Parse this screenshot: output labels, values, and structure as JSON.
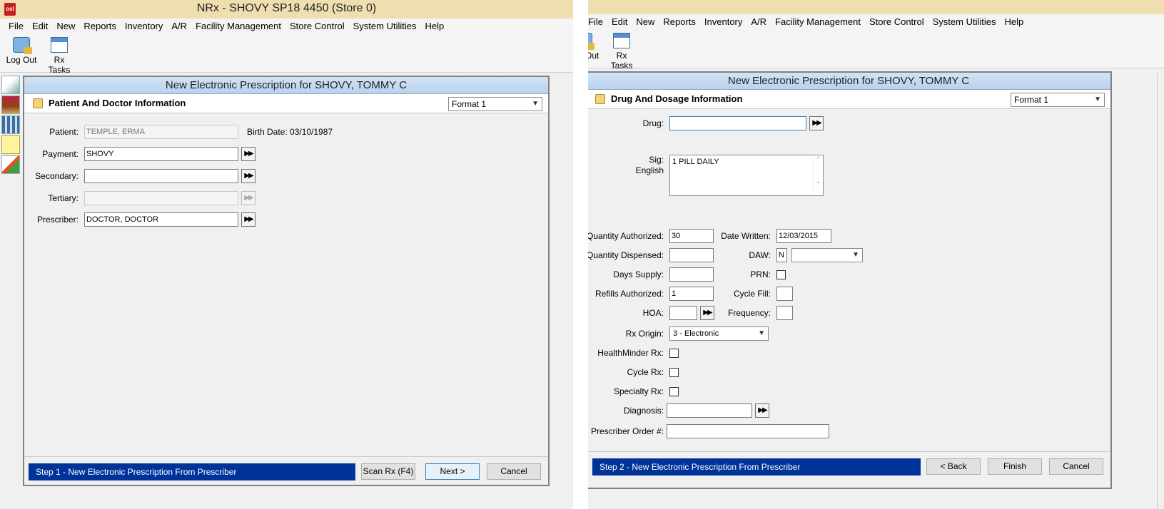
{
  "left": {
    "title": "NRx - SHOVY SP18 4450 (Store 0)",
    "app_icon": "osl",
    "menu": [
      "File",
      "Edit",
      "New",
      "Reports",
      "Inventory",
      "A/R",
      "Facility Management",
      "Store Control",
      "System Utilities",
      "Help"
    ],
    "toolbar": {
      "logout": "Log Out",
      "rxtasks": "Rx Tasks"
    },
    "dialog_title": "New Electronic Prescription  for SHOVY, TOMMY C",
    "section": "Patient And Doctor Information",
    "format": "Format 1",
    "labels": {
      "patient": "Patient:",
      "payment": "Payment:",
      "secondary": "Secondary:",
      "tertiary": "Tertiary:",
      "prescriber": "Prescriber:",
      "birth": "Birth Date: 03/10/1987"
    },
    "values": {
      "patient": "TEMPLE, ERMA",
      "payment": "SHOVY",
      "secondary": "",
      "tertiary": "",
      "prescriber": "DOCTOR, DOCTOR"
    },
    "step": "Step 1 - New Electronic Prescription From Prescriber",
    "buttons": {
      "scan": "Scan Rx (F4)",
      "next": "Next >",
      "cancel": "Cancel"
    }
  },
  "right": {
    "app_icon": "osl",
    "menu": [
      "File",
      "Edit",
      "New",
      "Reports",
      "Inventory",
      "A/R",
      "Facility Management",
      "Store Control",
      "System Utilities",
      "Help"
    ],
    "toolbar": {
      "logout": "Log Out",
      "rxtasks": "Rx Tasks"
    },
    "dialog_title": "New Electronic Prescription  for SHOVY, TOMMY C",
    "section": "Drug And Dosage Information",
    "format": "Format 1",
    "labels": {
      "drug": "Drug:",
      "sig": "Sig:",
      "english": "English",
      "qty_auth": "Quantity Authorized:",
      "date_written": "Date Written:",
      "qty_disp": "Quantity Dispensed:",
      "daw": "DAW:",
      "days": "Days Supply:",
      "prn": "PRN:",
      "refills": "Refills Authorized:",
      "cycle_fill": "Cycle Fill:",
      "hoa": "HOA:",
      "frequency": "Frequency:",
      "rx_origin": "Rx Origin:",
      "healthminder": "HealthMinder Rx:",
      "cycle_rx": "Cycle Rx:",
      "specialty": "Specialty Rx:",
      "diagnosis": "Diagnosis:",
      "prescriber_order": "Prescriber Order #:"
    },
    "values": {
      "drug": "",
      "sig": "1 PILL DAILY",
      "qty_auth": "30",
      "date_written": "12/03/2015",
      "qty_disp": "",
      "daw": "N",
      "days": "",
      "refills": "1",
      "cycle_fill": "",
      "hoa": "",
      "frequency": "",
      "rx_origin": "3 - Electronic",
      "diagnosis": "",
      "prescriber_order": ""
    },
    "step": "Step 2 - New Electronic Prescription From Prescriber",
    "buttons": {
      "back": "< Back",
      "finish": "Finish",
      "cancel": "Cancel"
    }
  }
}
